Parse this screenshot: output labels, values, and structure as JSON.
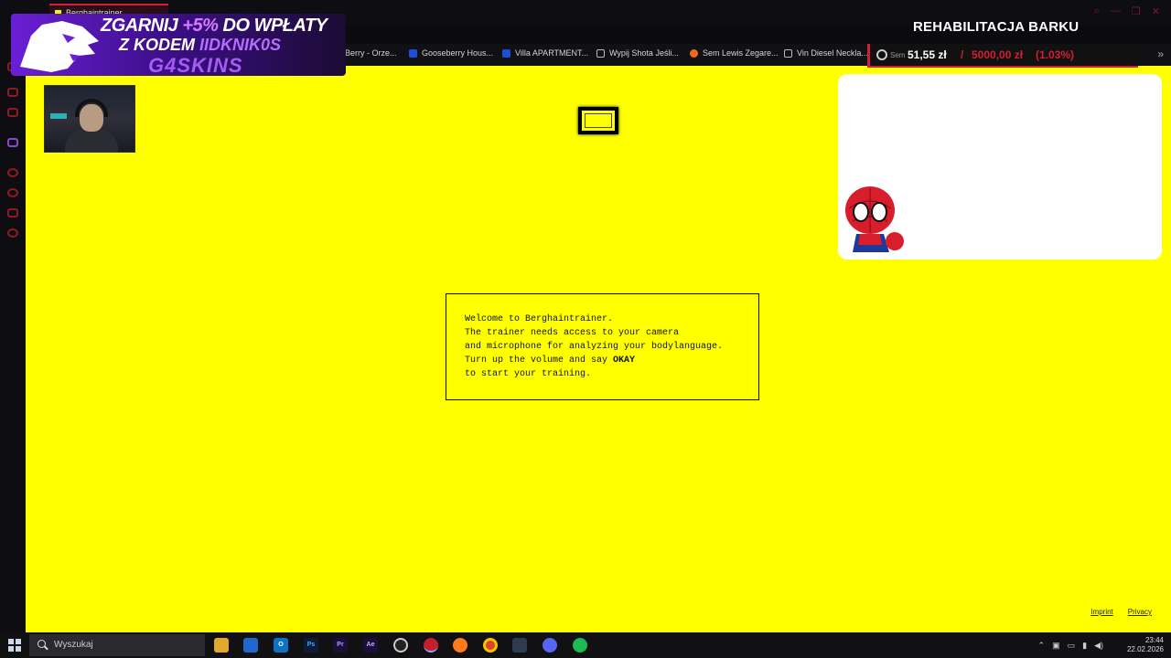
{
  "browser": {
    "tab_title": "Berghaintrainer",
    "bookmarks": [
      "Berry - Orze...",
      "Gooseberry Hous...",
      "Villa APARTMENT...",
      "Wypij Shota Jeśli...",
      "Sem Lewis Zegare...",
      "Vin Diesel Neckla..."
    ]
  },
  "page": {
    "welcome_lines": [
      "Welcome to Berghaintrainer.",
      "The trainer needs access to your camera",
      "and microphone for analyzing your bodylanguage.",
      "Turn up the volume and say",
      "to start your training."
    ],
    "okay_word": "OKAY",
    "footer": {
      "imprint": "Imprint",
      "privacy": "Privacy"
    }
  },
  "overlay": {
    "promo": {
      "line1_a": "ZGARNIJ",
      "line1_hl": "+5%",
      "line1_b": "DO WPŁATY",
      "line2_a": "Z KODEM",
      "line2_hl": "IIDKNIK0S",
      "line3": "G4SKINS"
    },
    "goal": {
      "title": "REHABILITACJA BARKU",
      "sem_label": "Sem",
      "current": "51,55 zł",
      "separator": "/",
      "total": "5000,00 zł",
      "percent": "(1.03%)",
      "accent": "#d21f35"
    }
  },
  "taskbar": {
    "search_placeholder": "Wyszukaj",
    "time": "23:44",
    "date": "22.02.2026"
  }
}
